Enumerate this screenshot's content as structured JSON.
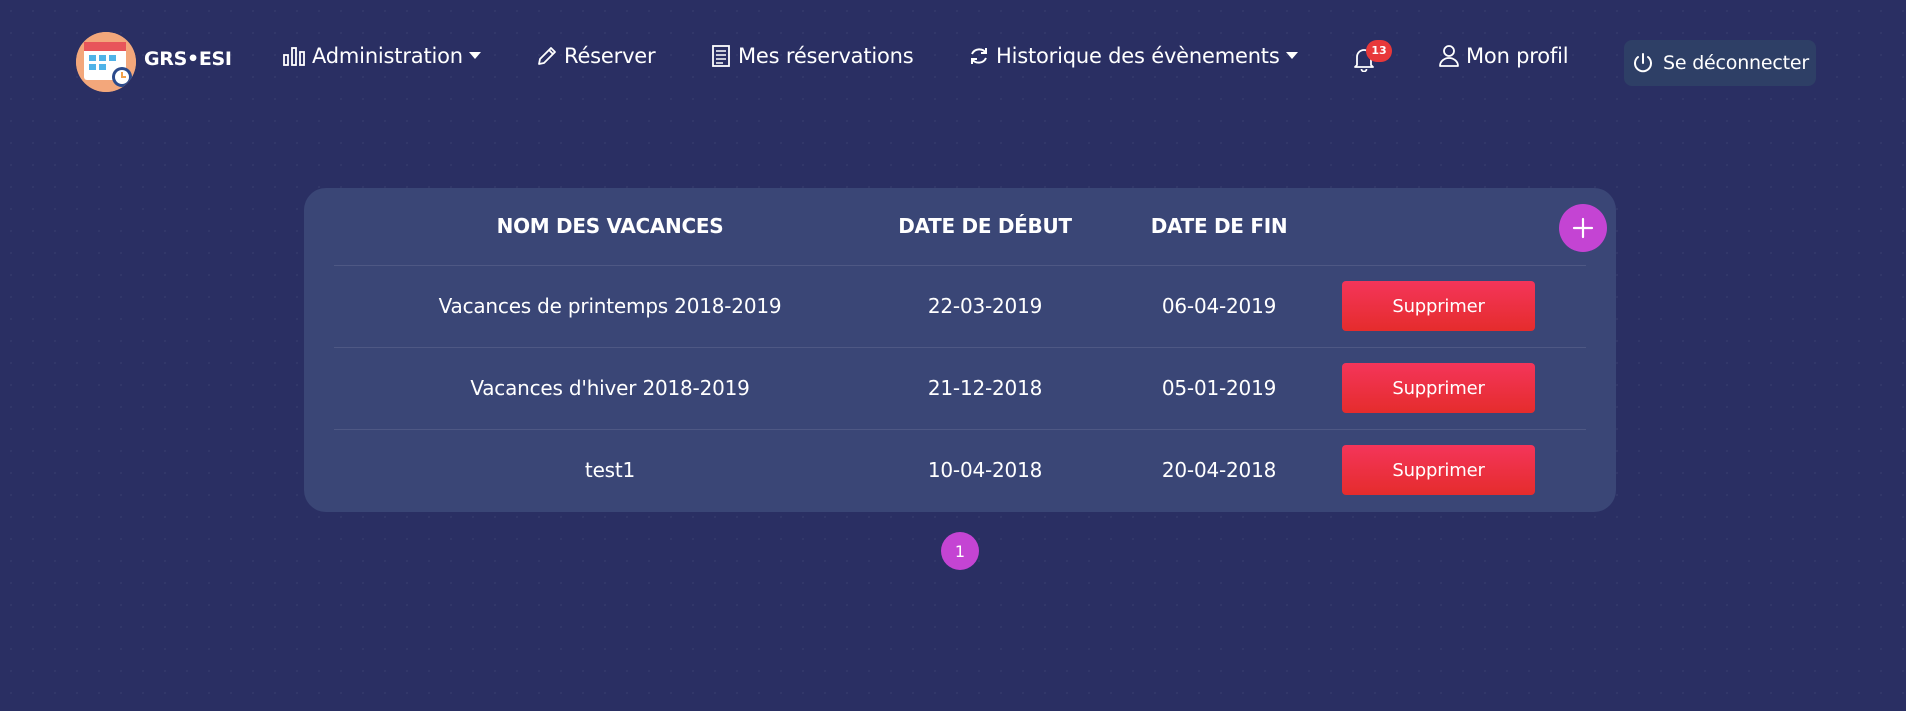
{
  "brand": {
    "name": "GRS•ESI",
    "icon": "calendar-clock-logo"
  },
  "nav": {
    "administration": "Administration",
    "reserver": "Réserver",
    "mes_reservations": "Mes réservations",
    "historique": "Historique des évènements",
    "notifications_count": "13",
    "profil": "Mon profil",
    "logout": "Se déconnecter"
  },
  "table": {
    "headers": {
      "name": "NOM DES VACANCES",
      "start": "DATE DE DÉBUT",
      "end": "DATE DE FIN"
    },
    "rows": [
      {
        "name": "Vacances de printemps 2018-2019",
        "start": "22-03-2019",
        "end": "06-04-2019",
        "action": "Supprimer"
      },
      {
        "name": "Vacances d'hiver 2018-2019",
        "start": "21-12-2018",
        "end": "05-01-2019",
        "action": "Supprimer"
      },
      {
        "name": "test1",
        "start": "10-04-2018",
        "end": "20-04-2018",
        "action": "Supprimer"
      }
    ]
  },
  "pagination": {
    "current": "1"
  },
  "colors": {
    "background": "#2a2f63",
    "card": "#3a4676",
    "accent": "#c444d3",
    "danger": "#e8383a",
    "logout_bg": "#2e3f66"
  }
}
